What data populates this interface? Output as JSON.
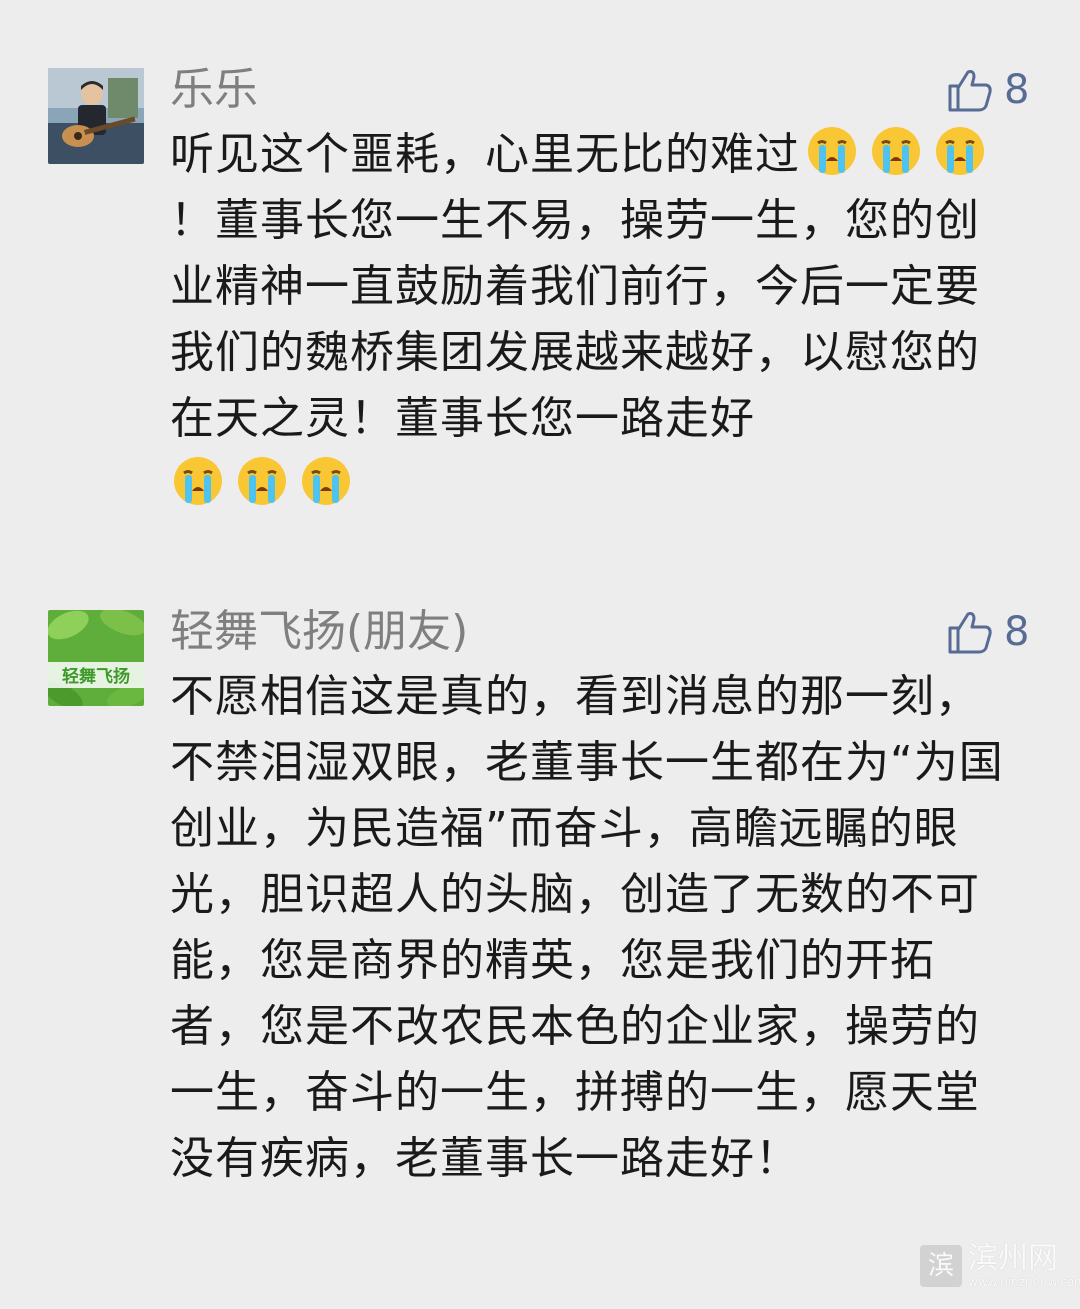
{
  "comments": [
    {
      "username": "乐乐",
      "likes": "8",
      "avatar": "boy-with-guitar-photo",
      "segments": [
        "听见这个噩耗，心里无比的难过",
        "！董事长您一生不易，操劳一生，您的创业精神一直鼓励着我们前行，今后一定要我们的魏桥集团发展越来越好，以慰您的在天之灵！董事长您一路走好"
      ],
      "emoji": "crying-face-emoji"
    },
    {
      "username": "轻舞飞扬(朋友)",
      "likes": "8",
      "avatar": "green-leaves-logo",
      "avatar_text": "轻舞飞扬",
      "text": "不愿相信这是真的，看到消息的那一刻，不禁泪湿双眼，老董事长一生都在为“为国创业，为民造福”而奋斗，高瞻远瞩的眼光，胆识超人的头脑，创造了无数的不可能，您是商界的精英，您是我们的开拓者，您是不改农民本色的企业家，操劳的一生，奋斗的一生，拼搏的一生，愿天堂没有疾病，老董事长一路走好！"
    }
  ],
  "watermark": {
    "logo_char": "滨",
    "name": "滨州网",
    "url": "www.binzhouw.com"
  },
  "colors": {
    "background": "#ededed",
    "username": "#7f7f7f",
    "like_accent": "#576b95",
    "text": "#1a1a1a"
  }
}
